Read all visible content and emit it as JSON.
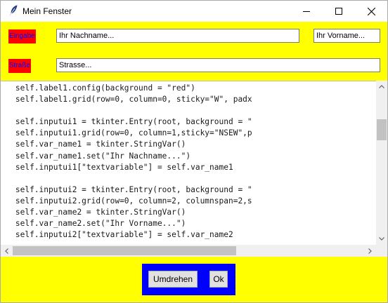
{
  "window": {
    "title": "Mein Fenster",
    "icon": "feather-icon"
  },
  "form": {
    "label_eingabe": "Eingabe",
    "label_strasse": "Straße",
    "input_nachname": "Ihr Nachname...",
    "input_vorname": "Ihr Vorname...",
    "input_strasse": "Strasse..."
  },
  "code_lines": [
    "        self.label1.config(background = \"red\")",
    "        self.label1.grid(row=0, column=0, sticky=\"W\", padx",
    "",
    "        self.inputui1 = tkinter.Entry(root, background = \"",
    "        self.inputui1.grid(row=0, column=1,sticky=\"NSEW\",p",
    "        self.var_name1 = tkinter.StringVar()",
    "        self.var_name1.set(\"Ihr Nachname...\")",
    "        self.inputui1[\"textvariable\"] = self.var_name1",
    "",
    "        self.inputui2 = tkinter.Entry(root, background = \"",
    "        self.inputui2.grid(row=0, column=2, columnspan=2,s",
    "        self.var_name2 = tkinter.StringVar()",
    "        self.var_name2.set(\"Ihr Vorname...\")",
    "        self.inputui2[\"textvariable\"] = self.var_name2"
  ],
  "buttons": {
    "umdrehen": "Umdrehen",
    "ok": "Ok"
  },
  "colors": {
    "background": "#ffff00",
    "label_bg": "#ff0000",
    "label_text": "#0000ff",
    "button_frame": "#0000ff"
  }
}
